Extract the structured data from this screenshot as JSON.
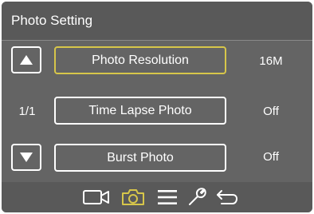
{
  "header": {
    "title": "Photo Setting"
  },
  "page_indicator": "1/1",
  "menu": {
    "items": [
      {
        "label": "Photo Resolution",
        "value": "16M",
        "selected": true
      },
      {
        "label": "Time Lapse Photo",
        "value": "Off",
        "selected": false
      },
      {
        "label": "Burst Photo",
        "value": "Off",
        "selected": false
      }
    ]
  },
  "icons": {
    "up": "arrow-up-icon",
    "down": "arrow-down-icon",
    "footer": [
      "video-camera-icon",
      "camera-icon",
      "menu-icon",
      "wrench-icon",
      "back-icon"
    ]
  },
  "colors": {
    "accent": "#d7c64a",
    "background": "#646464",
    "bar": "#595959",
    "text": "#ffffff"
  }
}
